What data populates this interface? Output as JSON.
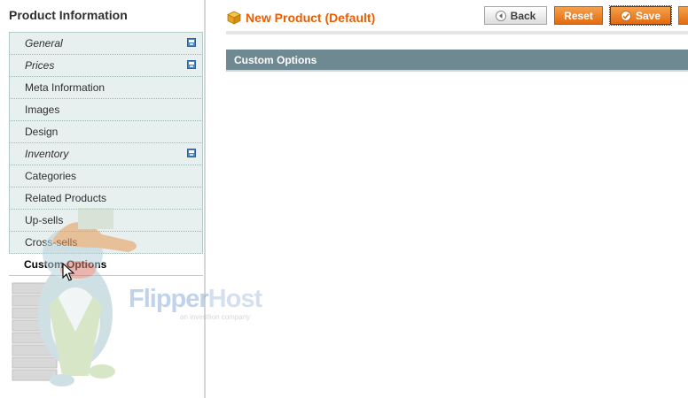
{
  "sidebar": {
    "title": "Product Information",
    "tabs": [
      {
        "label": "General",
        "italic": true,
        "changed": true
      },
      {
        "label": "Prices",
        "italic": true,
        "changed": true
      },
      {
        "label": "Meta Information",
        "italic": false,
        "changed": false
      },
      {
        "label": "Images",
        "italic": false,
        "changed": false
      },
      {
        "label": "Design",
        "italic": false,
        "changed": false
      },
      {
        "label": "Inventory",
        "italic": true,
        "changed": true
      },
      {
        "label": "Categories",
        "italic": false,
        "changed": false
      },
      {
        "label": "Related Products",
        "italic": false,
        "changed": false
      },
      {
        "label": "Up-sells",
        "italic": false,
        "changed": false
      },
      {
        "label": "Cross-sells",
        "italic": false,
        "changed": false
      },
      {
        "label": "Custom Options",
        "italic": false,
        "changed": false,
        "active": true
      }
    ]
  },
  "header": {
    "title": "New Product (Default)",
    "icon": "product-box-icon"
  },
  "toolbar": {
    "back_label": "Back",
    "reset_label": "Reset",
    "save_label": "Save"
  },
  "section": {
    "title": "Custom Options"
  },
  "watermark": {
    "brand_a": "Flipper",
    "brand_b": "Host",
    "tagline": "an investlion company"
  },
  "colors": {
    "accent_orange": "#eb5e00",
    "button_orange": "#e36b10",
    "section_header": "#6f8992",
    "tab_background": "#e7efef"
  }
}
